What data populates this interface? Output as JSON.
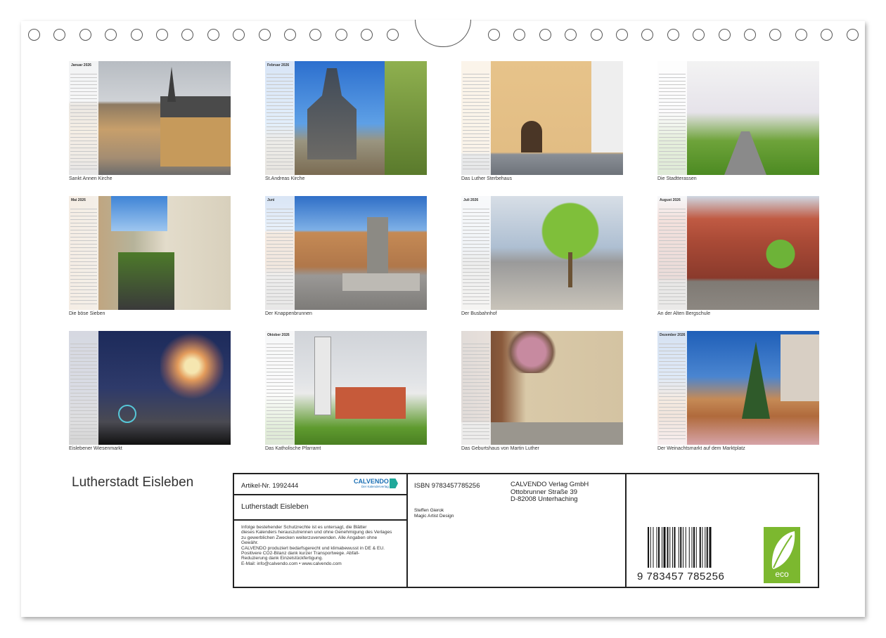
{
  "calendar_title": "Lutherstadt Eisleben",
  "tiles": [
    {
      "month": "Januar 2026",
      "caption": "Sankt Annen Kirche"
    },
    {
      "month": "Februar 2026",
      "caption": "St.Andreas Kirche"
    },
    {
      "month": "",
      "caption": "Das Luther Sterbehaus"
    },
    {
      "month": "",
      "caption": "Die Stadtterassen"
    },
    {
      "month": "Mai 2026",
      "caption": "Die böse Sieben"
    },
    {
      "month": "Juni",
      "caption": "Der Knappenbrunnen"
    },
    {
      "month": "Juli 2026",
      "caption": "Der Busbahnhof"
    },
    {
      "month": "August 2026",
      "caption": "An der Alten Bergschule"
    },
    {
      "month": "",
      "caption": "Eislebener Wiesenmarkt"
    },
    {
      "month": "Oktober 2026",
      "caption": "Das Katholische Pfarramt"
    },
    {
      "month": "",
      "caption": "Das Geburtshaus von Martin Luther"
    },
    {
      "month": "Dezember 2026",
      "caption": "Der Weinachtsmarkt auf dem Marktplatz"
    }
  ],
  "info": {
    "article": "Artikel-Nr. 1992444",
    "brand": "CALVENDO",
    "brand_sub": "Der Kalenderverlag",
    "book_title": "Lutherstadt Eisleben",
    "legal_lines": [
      "Infolge bestehender Schutzrechte ist es untersagt, die Blätter",
      "dieses Kalenders herauszutrennen und ohne Genehmigung des Verlages",
      "zu gewerblichen Zwecken weiterzuverwenden. Alle Angaben ohne",
      "Gewähr.",
      "CALVENDO produziert bedarfsgerecht und klimabewusst in DE & EU.",
      "Positivere CO2-Bilanz dank kurzer Transportwege. Abfall-",
      "Reduzierung dank Einzelstückfertigung.",
      "E-Mail: info@calvendo.com • www.calvendo.com"
    ],
    "isbn": "ISBN 9783457785256",
    "publisher": "CALVENDO Verlag GmbH",
    "street": "Ottobrunner Straße 39",
    "city": "D-82008 Unterhaching",
    "author": "Steffen Gierok",
    "author_sub": "Magic Artist Design",
    "barcode_number": "9 783457 785256",
    "eco_label": "eco"
  },
  "colors": {
    "frame": "#222222",
    "eco_green": "#7cb82f",
    "brand_blue": "#1a6fb4"
  }
}
